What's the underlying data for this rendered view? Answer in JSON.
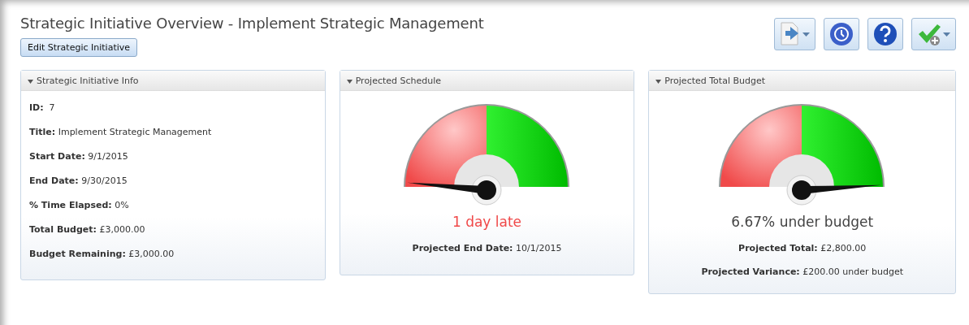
{
  "page": {
    "title": "Strategic Initiative Overview - Implement Strategic Management",
    "edit_button": "Edit Strategic Initiative"
  },
  "toolbar": [
    {
      "kind": "export",
      "dropdown": true
    },
    {
      "kind": "history",
      "dropdown": false
    },
    {
      "kind": "help",
      "dropdown": false
    },
    {
      "kind": "approve",
      "dropdown": true
    }
  ],
  "info_panel": {
    "title": "Strategic Initiative Info",
    "expanded": true,
    "fields": [
      "**ID:**  7",
      "**Title:** Implement Strategic Management",
      "**Start Date:** 9/1/2015",
      "**End Date:** 9/30/2015",
      "**% Time Elapsed:** 0%",
      "**Total Budget:** £3,000.00",
      "**Budget Remaining:** £3,000.00"
    ]
  },
  "gauges": [
    {
      "title": "Projected Schedule",
      "expanded": true,
      "status": "1 day late",
      "color": "#f04848",
      "details": [
        "**Projected End Date:** 10/1/2015"
      ]
    },
    {
      "title": "Projected Total Budget",
      "expanded": true,
      "status": "6.67% under budget",
      "color": "#444444",
      "details": [
        "**Projected Total:** £2,800.00",
        "**Projected Variance:** £200.00 under budget"
      ]
    }
  ]
}
